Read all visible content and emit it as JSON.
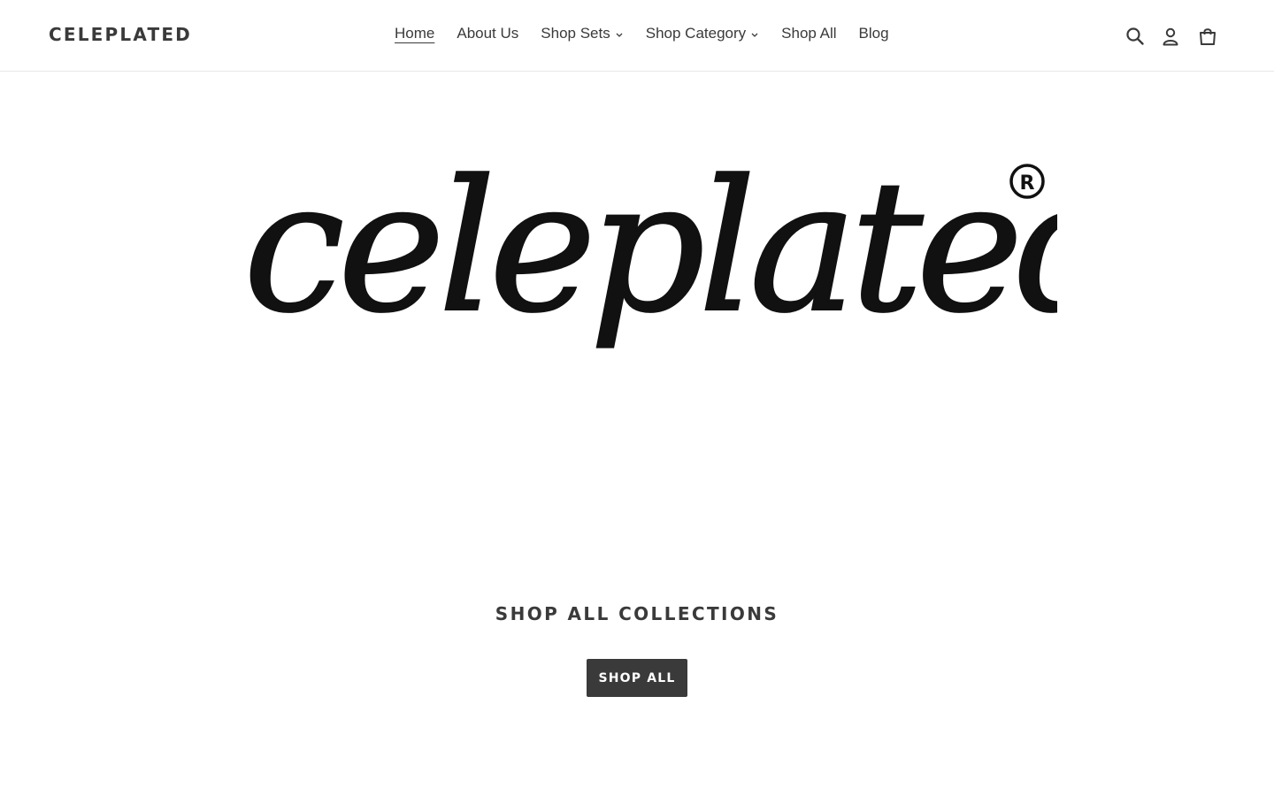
{
  "header": {
    "logo_text": "CELEPLATED",
    "nav": [
      {
        "label": "Home",
        "active": true,
        "dropdown": false
      },
      {
        "label": "About Us",
        "active": false,
        "dropdown": false
      },
      {
        "label": "Shop Sets",
        "active": false,
        "dropdown": true
      },
      {
        "label": "Shop Category",
        "active": false,
        "dropdown": true
      },
      {
        "label": "Shop All",
        "active": false,
        "dropdown": false
      },
      {
        "label": "Blog",
        "active": false,
        "dropdown": false
      }
    ],
    "icons": [
      "search-icon",
      "account-icon",
      "cart-icon"
    ]
  },
  "hero": {
    "logo_text": "celeplated",
    "registered_mark": "®"
  },
  "collections": {
    "title": "SHOP ALL COLLECTIONS",
    "button_label": "SHOP ALL"
  },
  "colors": {
    "text": "#3a3a3a",
    "button_bg": "#3a3a3a",
    "button_text": "#ffffff",
    "border": "#e8e8e8"
  }
}
